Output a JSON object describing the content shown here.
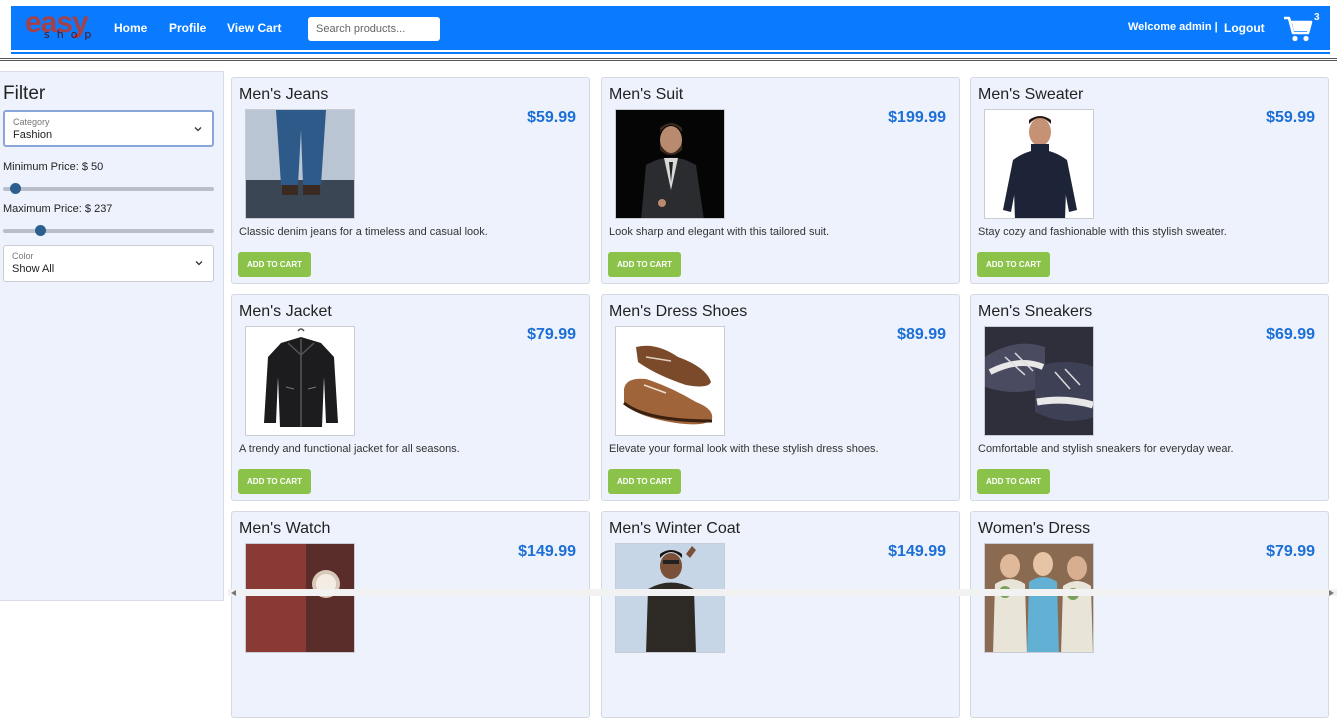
{
  "header": {
    "logo_top": "easy",
    "logo_bottom": "shop",
    "nav": [
      "Home",
      "Profile",
      "View Cart"
    ],
    "search_placeholder": "Search products...",
    "welcome": "Welcome admin |",
    "logout": "Logout",
    "cart_count": "3",
    "accent_color": "#0a7bff"
  },
  "sidebar": {
    "title": "Filter",
    "category": {
      "label": "Category",
      "value": "Fashion"
    },
    "min_price_label": "Minimum Price: $ 50",
    "min_price_value": 50,
    "max_price_label": "Maximum Price: $ 237",
    "max_price_value": 237,
    "color": {
      "label": "Color",
      "value": "Show All"
    }
  },
  "products": [
    {
      "name": "Men's Jeans",
      "price": "$59.99",
      "description": "Classic denim jeans for a timeless and casual look.",
      "button": "ADD TO CART",
      "image": "jeans"
    },
    {
      "name": "Men's Suit",
      "price": "$199.99",
      "description": "Look sharp and elegant with this tailored suit.",
      "button": "ADD TO CART",
      "image": "suit"
    },
    {
      "name": "Men's Sweater",
      "price": "$59.99",
      "description": "Stay cozy and fashionable with this stylish sweater.",
      "button": "ADD TO CART",
      "image": "sweater"
    },
    {
      "name": "Men's Jacket",
      "price": "$79.99",
      "description": "A trendy and functional jacket for all seasons.",
      "button": "ADD TO CART",
      "image": "jacket"
    },
    {
      "name": "Men's Dress Shoes",
      "price": "$89.99",
      "description": "Elevate your formal look with these stylish dress shoes.",
      "button": "ADD TO CART",
      "image": "shoes"
    },
    {
      "name": "Men's Sneakers",
      "price": "$69.99",
      "description": "Comfortable and stylish sneakers for everyday wear.",
      "button": "ADD TO CART",
      "image": "sneakers"
    },
    {
      "name": "Men's Watch",
      "price": "$149.99",
      "description": "",
      "button": "",
      "image": "watch"
    },
    {
      "name": "Men's Winter Coat",
      "price": "$149.99",
      "description": "",
      "button": "",
      "image": "coat"
    },
    {
      "name": "Women's Dress",
      "price": "$79.99",
      "description": "",
      "button": "",
      "image": "dress"
    }
  ]
}
